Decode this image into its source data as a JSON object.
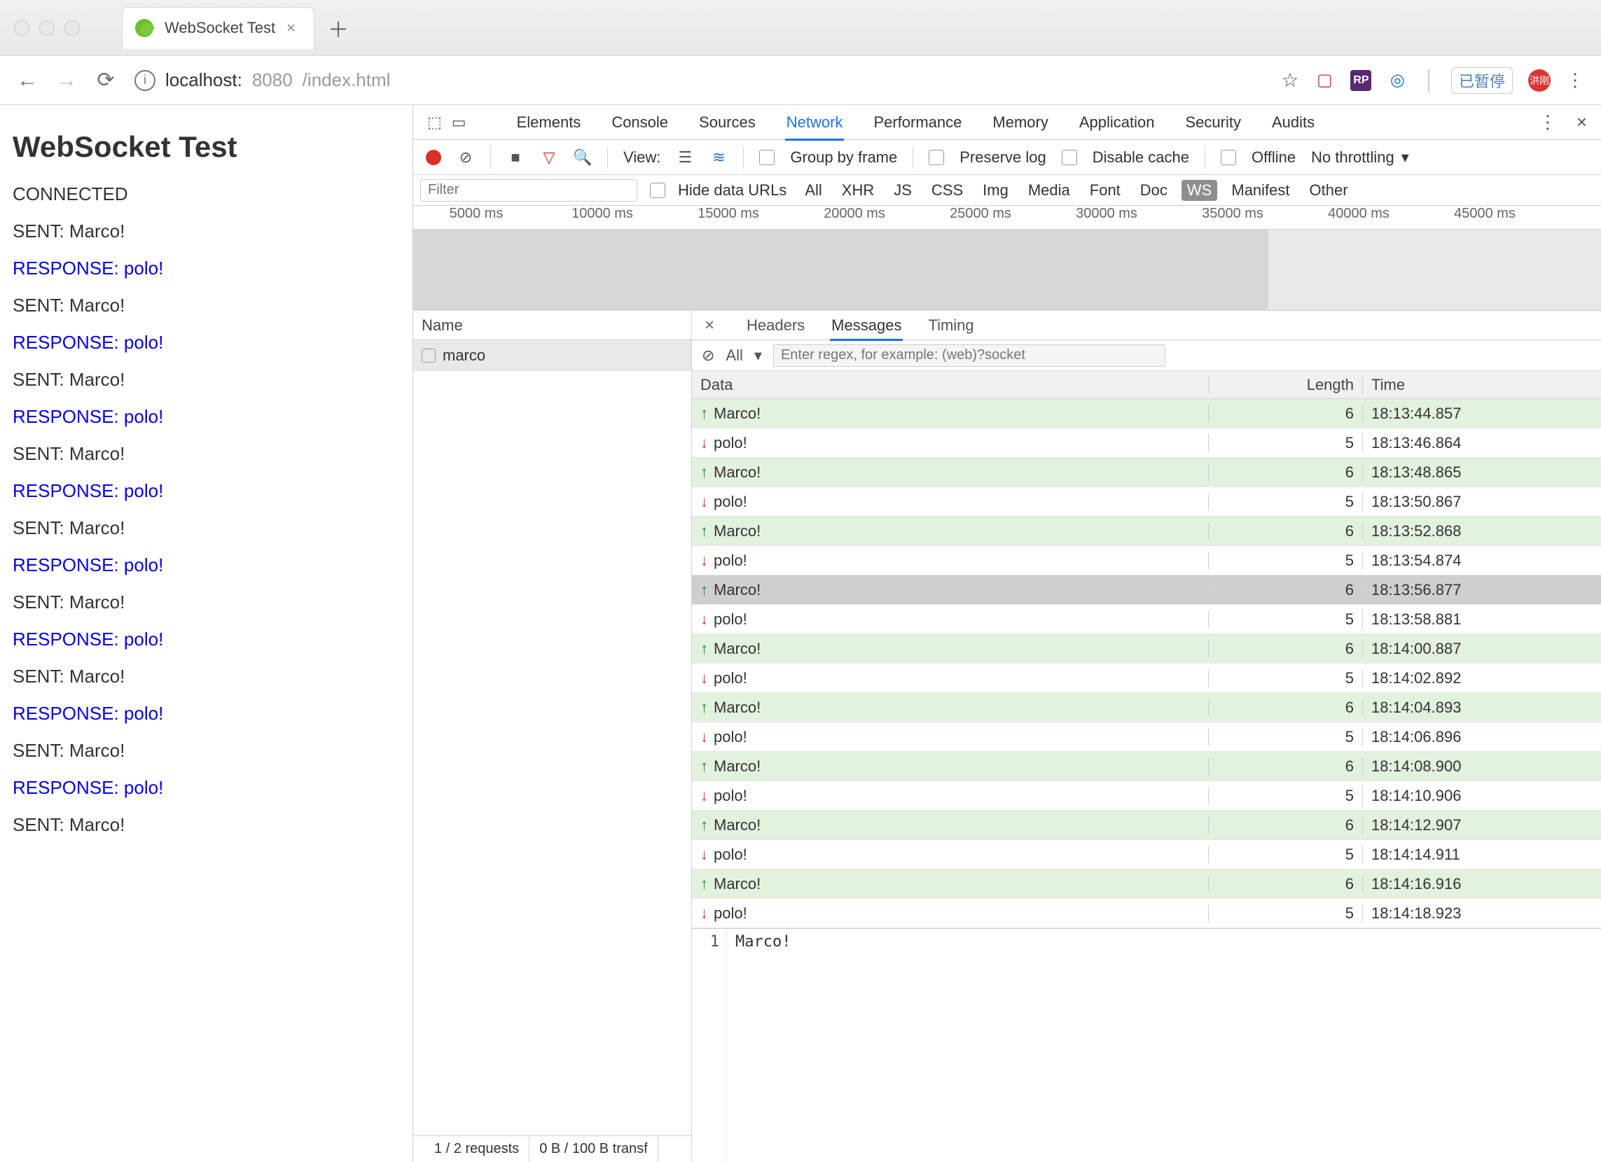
{
  "browser": {
    "tab_title": "WebSocket Test",
    "url_host": "localhost:",
    "url_port": "8080",
    "url_path": "/index.html",
    "pause_label": "已暂停",
    "avatar_text": "洪刚"
  },
  "page": {
    "heading": "WebSocket Test",
    "log": [
      {
        "text": "CONNECTED",
        "kind": "plain"
      },
      {
        "text": "SENT: Marco!",
        "kind": "plain"
      },
      {
        "text": "RESPONSE: polo!",
        "kind": "resp"
      },
      {
        "text": "SENT: Marco!",
        "kind": "plain"
      },
      {
        "text": "RESPONSE: polo!",
        "kind": "resp"
      },
      {
        "text": "SENT: Marco!",
        "kind": "plain"
      },
      {
        "text": "RESPONSE: polo!",
        "kind": "resp"
      },
      {
        "text": "SENT: Marco!",
        "kind": "plain"
      },
      {
        "text": "RESPONSE: polo!",
        "kind": "resp"
      },
      {
        "text": "SENT: Marco!",
        "kind": "plain"
      },
      {
        "text": "RESPONSE: polo!",
        "kind": "resp"
      },
      {
        "text": "SENT: Marco!",
        "kind": "plain"
      },
      {
        "text": "RESPONSE: polo!",
        "kind": "resp"
      },
      {
        "text": "SENT: Marco!",
        "kind": "plain"
      },
      {
        "text": "RESPONSE: polo!",
        "kind": "resp"
      },
      {
        "text": "SENT: Marco!",
        "kind": "plain"
      },
      {
        "text": "RESPONSE: polo!",
        "kind": "resp"
      },
      {
        "text": "SENT: Marco!",
        "kind": "plain"
      }
    ]
  },
  "devtools": {
    "tabs": [
      "Elements",
      "Console",
      "Sources",
      "Network",
      "Performance",
      "Memory",
      "Application",
      "Security",
      "Audits"
    ],
    "active_tab": "Network",
    "toolbar": {
      "view_label": "View:",
      "group_frame_label": "Group by frame",
      "preserve_log_label": "Preserve log",
      "disable_cache_label": "Disable cache",
      "offline_label": "Offline",
      "throttling_label": "No throttling"
    },
    "filterbar": {
      "placeholder": "Filter",
      "hide_data_urls_label": "Hide data URLs",
      "types": [
        "All",
        "XHR",
        "JS",
        "CSS",
        "Img",
        "Media",
        "Font",
        "Doc",
        "WS",
        "Manifest",
        "Other"
      ],
      "active_type": "WS"
    },
    "timeline": {
      "ticks": [
        "5000 ms",
        "10000 ms",
        "15000 ms",
        "20000 ms",
        "25000 ms",
        "30000 ms",
        "35000 ms",
        "40000 ms",
        "45000 ms"
      ]
    },
    "request_list": {
      "header": "Name",
      "rows": [
        {
          "name": "marco"
        }
      ],
      "status_left": "1 / 2 requests",
      "status_right": "0 B / 100 B transf"
    },
    "detail": {
      "tabs": [
        "Headers",
        "Messages",
        "Timing"
      ],
      "active_tab": "Messages",
      "ws": {
        "filter_all_label": "All",
        "regex_placeholder": "Enter regex, for example: (web)?socket",
        "cols": {
          "data": "Data",
          "length": "Length",
          "time": "Time"
        },
        "messages": [
          {
            "dir": "up",
            "data": "Marco!",
            "len": "6",
            "time": "18:13:44.857"
          },
          {
            "dir": "down",
            "data": "polo!",
            "len": "5",
            "time": "18:13:46.864"
          },
          {
            "dir": "up",
            "data": "Marco!",
            "len": "6",
            "time": "18:13:48.865"
          },
          {
            "dir": "down",
            "data": "polo!",
            "len": "5",
            "time": "18:13:50.867"
          },
          {
            "dir": "up",
            "data": "Marco!",
            "len": "6",
            "time": "18:13:52.868"
          },
          {
            "dir": "down",
            "data": "polo!",
            "len": "5",
            "time": "18:13:54.874"
          },
          {
            "dir": "up",
            "data": "Marco!",
            "len": "6",
            "time": "18:13:56.877",
            "selected": true
          },
          {
            "dir": "down",
            "data": "polo!",
            "len": "5",
            "time": "18:13:58.881"
          },
          {
            "dir": "up",
            "data": "Marco!",
            "len": "6",
            "time": "18:14:00.887"
          },
          {
            "dir": "down",
            "data": "polo!",
            "len": "5",
            "time": "18:14:02.892"
          },
          {
            "dir": "up",
            "data": "Marco!",
            "len": "6",
            "time": "18:14:04.893"
          },
          {
            "dir": "down",
            "data": "polo!",
            "len": "5",
            "time": "18:14:06.896"
          },
          {
            "dir": "up",
            "data": "Marco!",
            "len": "6",
            "time": "18:14:08.900"
          },
          {
            "dir": "down",
            "data": "polo!",
            "len": "5",
            "time": "18:14:10.906"
          },
          {
            "dir": "up",
            "data": "Marco!",
            "len": "6",
            "time": "18:14:12.907"
          },
          {
            "dir": "down",
            "data": "polo!",
            "len": "5",
            "time": "18:14:14.911"
          },
          {
            "dir": "up",
            "data": "Marco!",
            "len": "6",
            "time": "18:14:16.916"
          },
          {
            "dir": "down",
            "data": "polo!",
            "len": "5",
            "time": "18:14:18.923"
          }
        ],
        "payload": {
          "line_no": "1",
          "text": "Marco!"
        }
      }
    }
  }
}
